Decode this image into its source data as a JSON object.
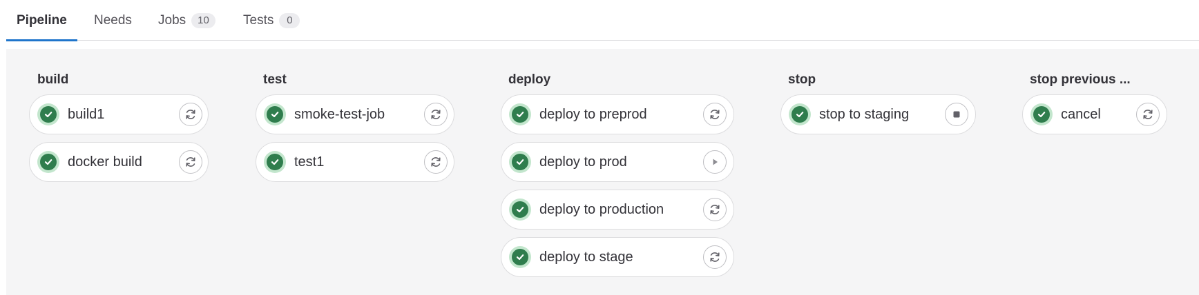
{
  "tabs": [
    {
      "label": "Pipeline",
      "active": true
    },
    {
      "label": "Needs"
    },
    {
      "label": "Jobs",
      "count": "10"
    },
    {
      "label": "Tests",
      "count": "0"
    }
  ],
  "stages": [
    {
      "title": "build",
      "jobs": [
        {
          "name": "build1",
          "status": "success",
          "action": "retry-icon"
        },
        {
          "name": "docker build",
          "status": "success",
          "action": "retry-icon"
        }
      ]
    },
    {
      "title": "test",
      "jobs": [
        {
          "name": "smoke-test-job",
          "status": "success",
          "action": "retry-icon"
        },
        {
          "name": "test1",
          "status": "success",
          "action": "retry-icon"
        }
      ]
    },
    {
      "title": "deploy",
      "jobs": [
        {
          "name": "deploy to preprod",
          "status": "success",
          "action": "retry-icon"
        },
        {
          "name": "deploy to prod",
          "status": "success",
          "action": "play-icon"
        },
        {
          "name": "deploy to production",
          "status": "success",
          "action": "retry-icon"
        },
        {
          "name": "deploy to stage",
          "status": "success",
          "action": "retry-icon"
        }
      ]
    },
    {
      "title": "stop",
      "jobs": [
        {
          "name": "stop to staging",
          "status": "success",
          "action": "stop-icon"
        }
      ]
    },
    {
      "title": "stop previous ...",
      "jobs": [
        {
          "name": "cancel",
          "status": "success",
          "action": "retry-icon"
        }
      ]
    }
  ],
  "colors": {
    "success": "#2f7d4d",
    "success_ring": "#c3e6cd",
    "tab_active_border": "#1f75cb",
    "canvas_bg": "#f5f5f6"
  }
}
